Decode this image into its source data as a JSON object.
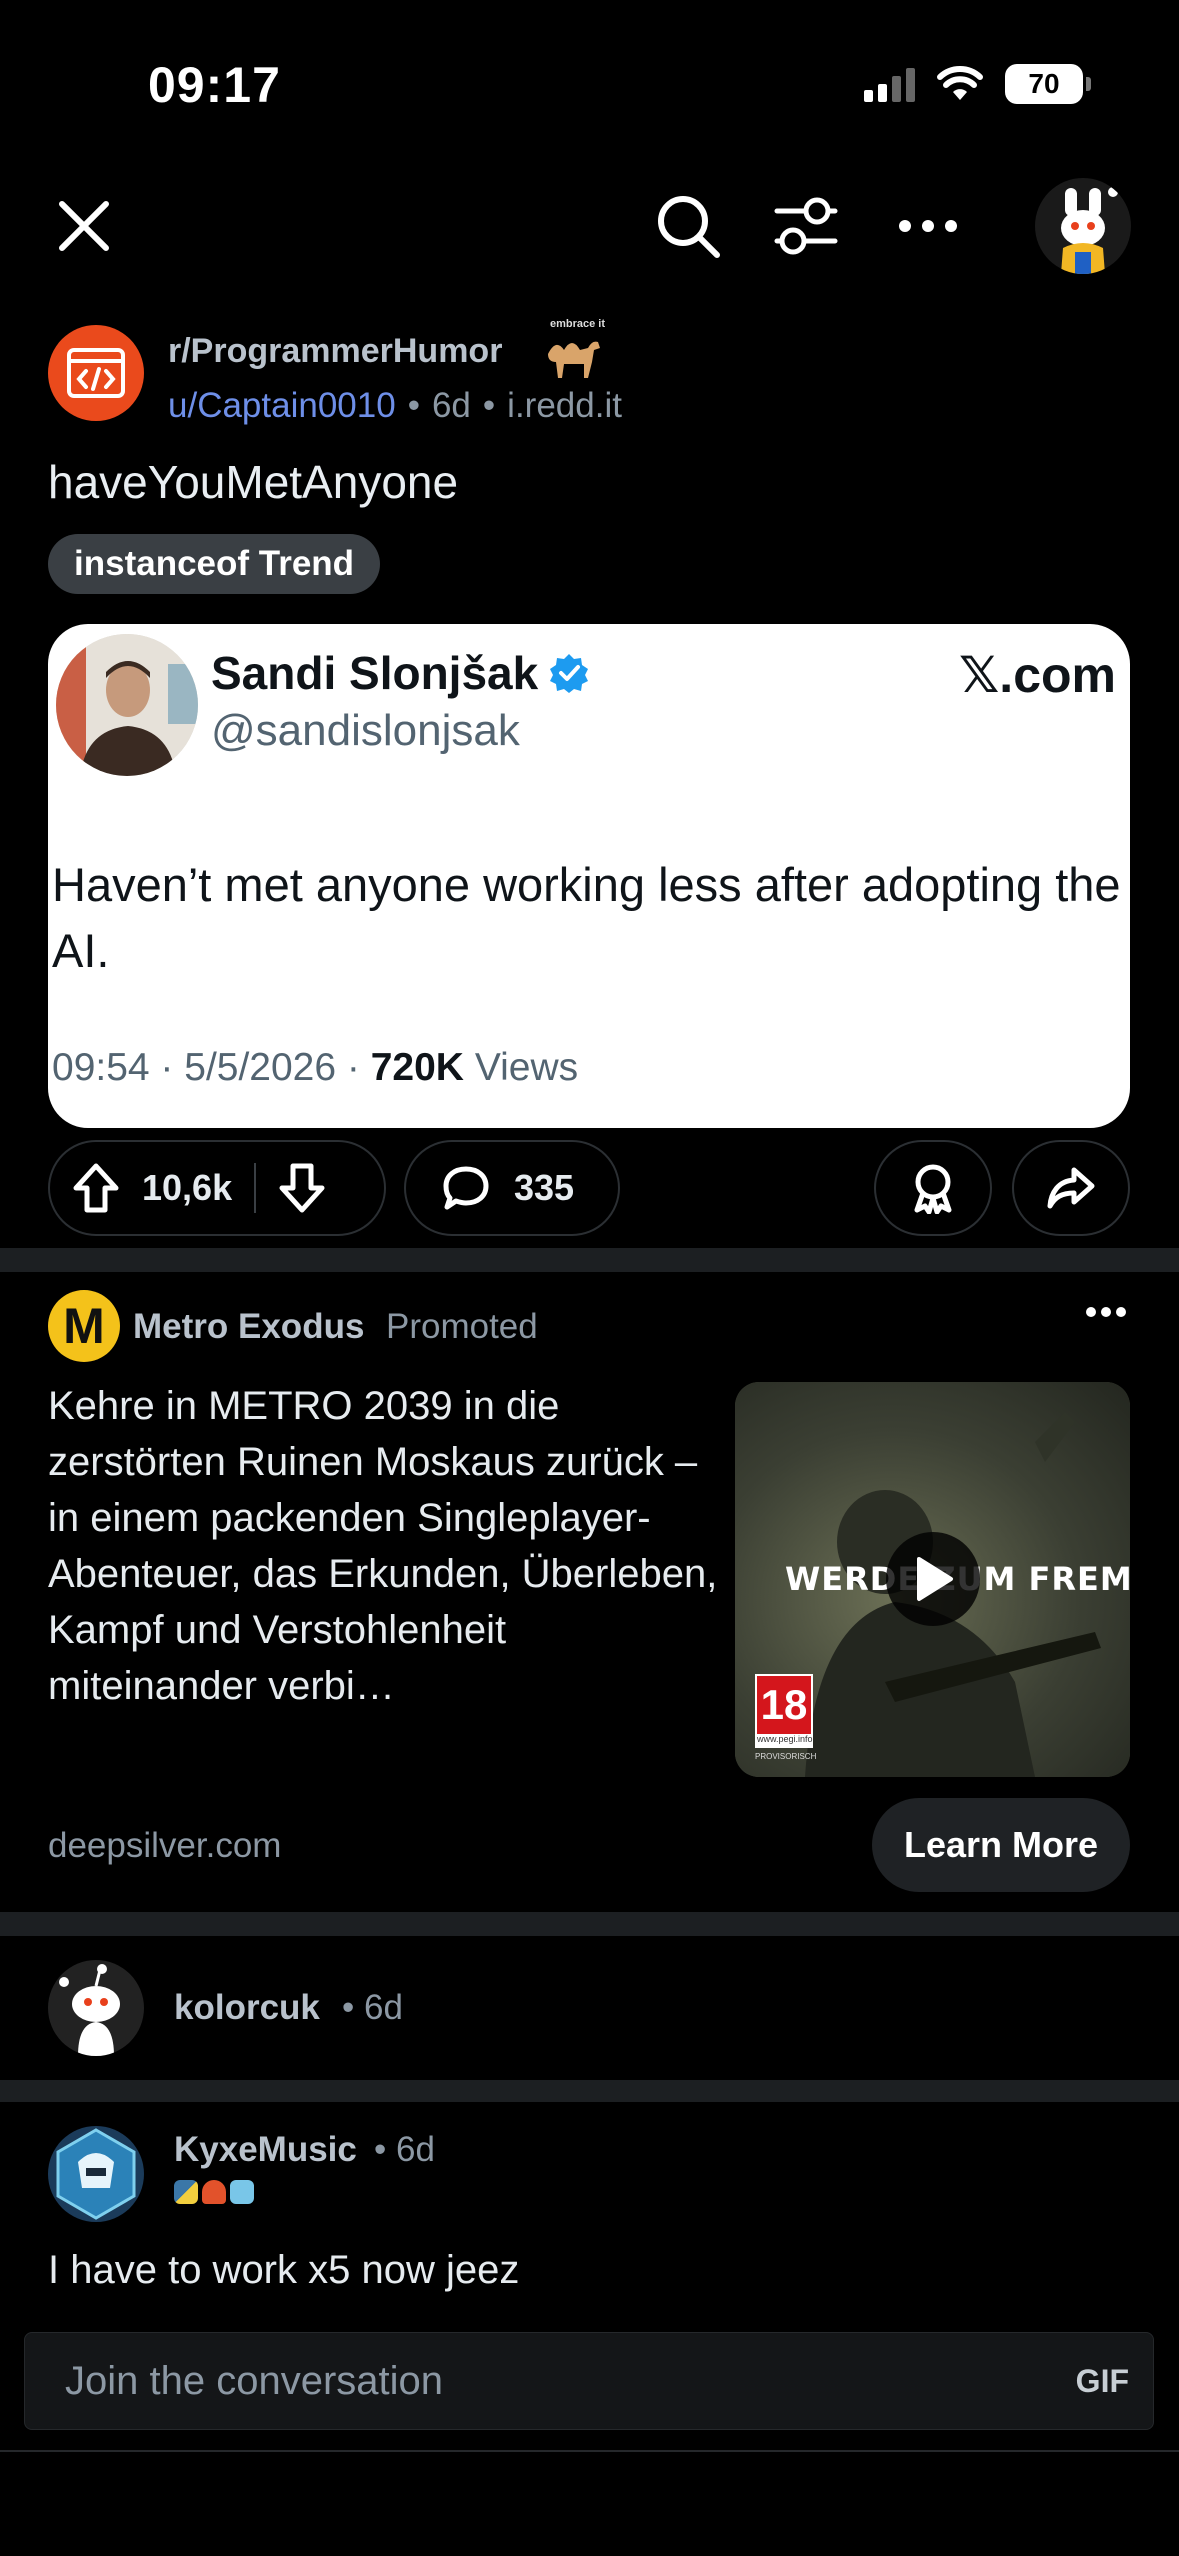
{
  "status_bar": {
    "time": "09:17",
    "battery": "70"
  },
  "nav": {
    "close_icon": "close-icon",
    "search_icon": "search-icon",
    "filter_icon": "filter-icon",
    "more_icon": "more-icon"
  },
  "post": {
    "subreddit": "r/ProgrammerHumor",
    "subreddit_badge_text": "embrace it",
    "author": "u/Captain0010",
    "age": "6d",
    "domain": "i.redd.it",
    "title": "haveYouMetAnyone",
    "flair": "instanceof Trend",
    "tweet": {
      "name": "Sandi Slonjšak",
      "handle": "@sandislonjsak",
      "brand": "𝕏.com",
      "text": "Haven’t met anyone working less after adopting the AI.",
      "timestamp": "09:54 · 5/5/2026 ·",
      "views_count": "720K",
      "views_label": "Views"
    },
    "upvotes": "10,6k",
    "comments": "335"
  },
  "ad": {
    "advertiser": "Metro Exodus",
    "promoted_label": "Promoted",
    "logo_letter": "M",
    "body": "Kehre in METRO 2039 in die zerstörten Ruinen Moskaus zurück – in einem packenden Singleplayer-Abenteuer, das Erkunden, Überleben, Kampf und Verstohlenheit miteinander verbi…",
    "thumb_overlay": "WERDE ZUM FREMDEN",
    "pegi": "18",
    "pegi_url": "www.pegi.info",
    "pegi_note": "PROVISORISCH",
    "domain": "deepsilver.com",
    "cta": "Learn More"
  },
  "comments": [
    {
      "user": "kolorcuk",
      "age": "6d"
    },
    {
      "user": "KyxeMusic",
      "age": "6d",
      "text": "I have to work x5 now jeez"
    }
  ],
  "composer": {
    "placeholder": "Join the conversation",
    "gif_label": "GIF"
  },
  "colors": {
    "background": "#000000",
    "subreddit_icon": "#ea4a1c",
    "username_link": "#6e8fe8",
    "verified": "#1d9bf0",
    "ad_logo": "#f4c21a"
  }
}
